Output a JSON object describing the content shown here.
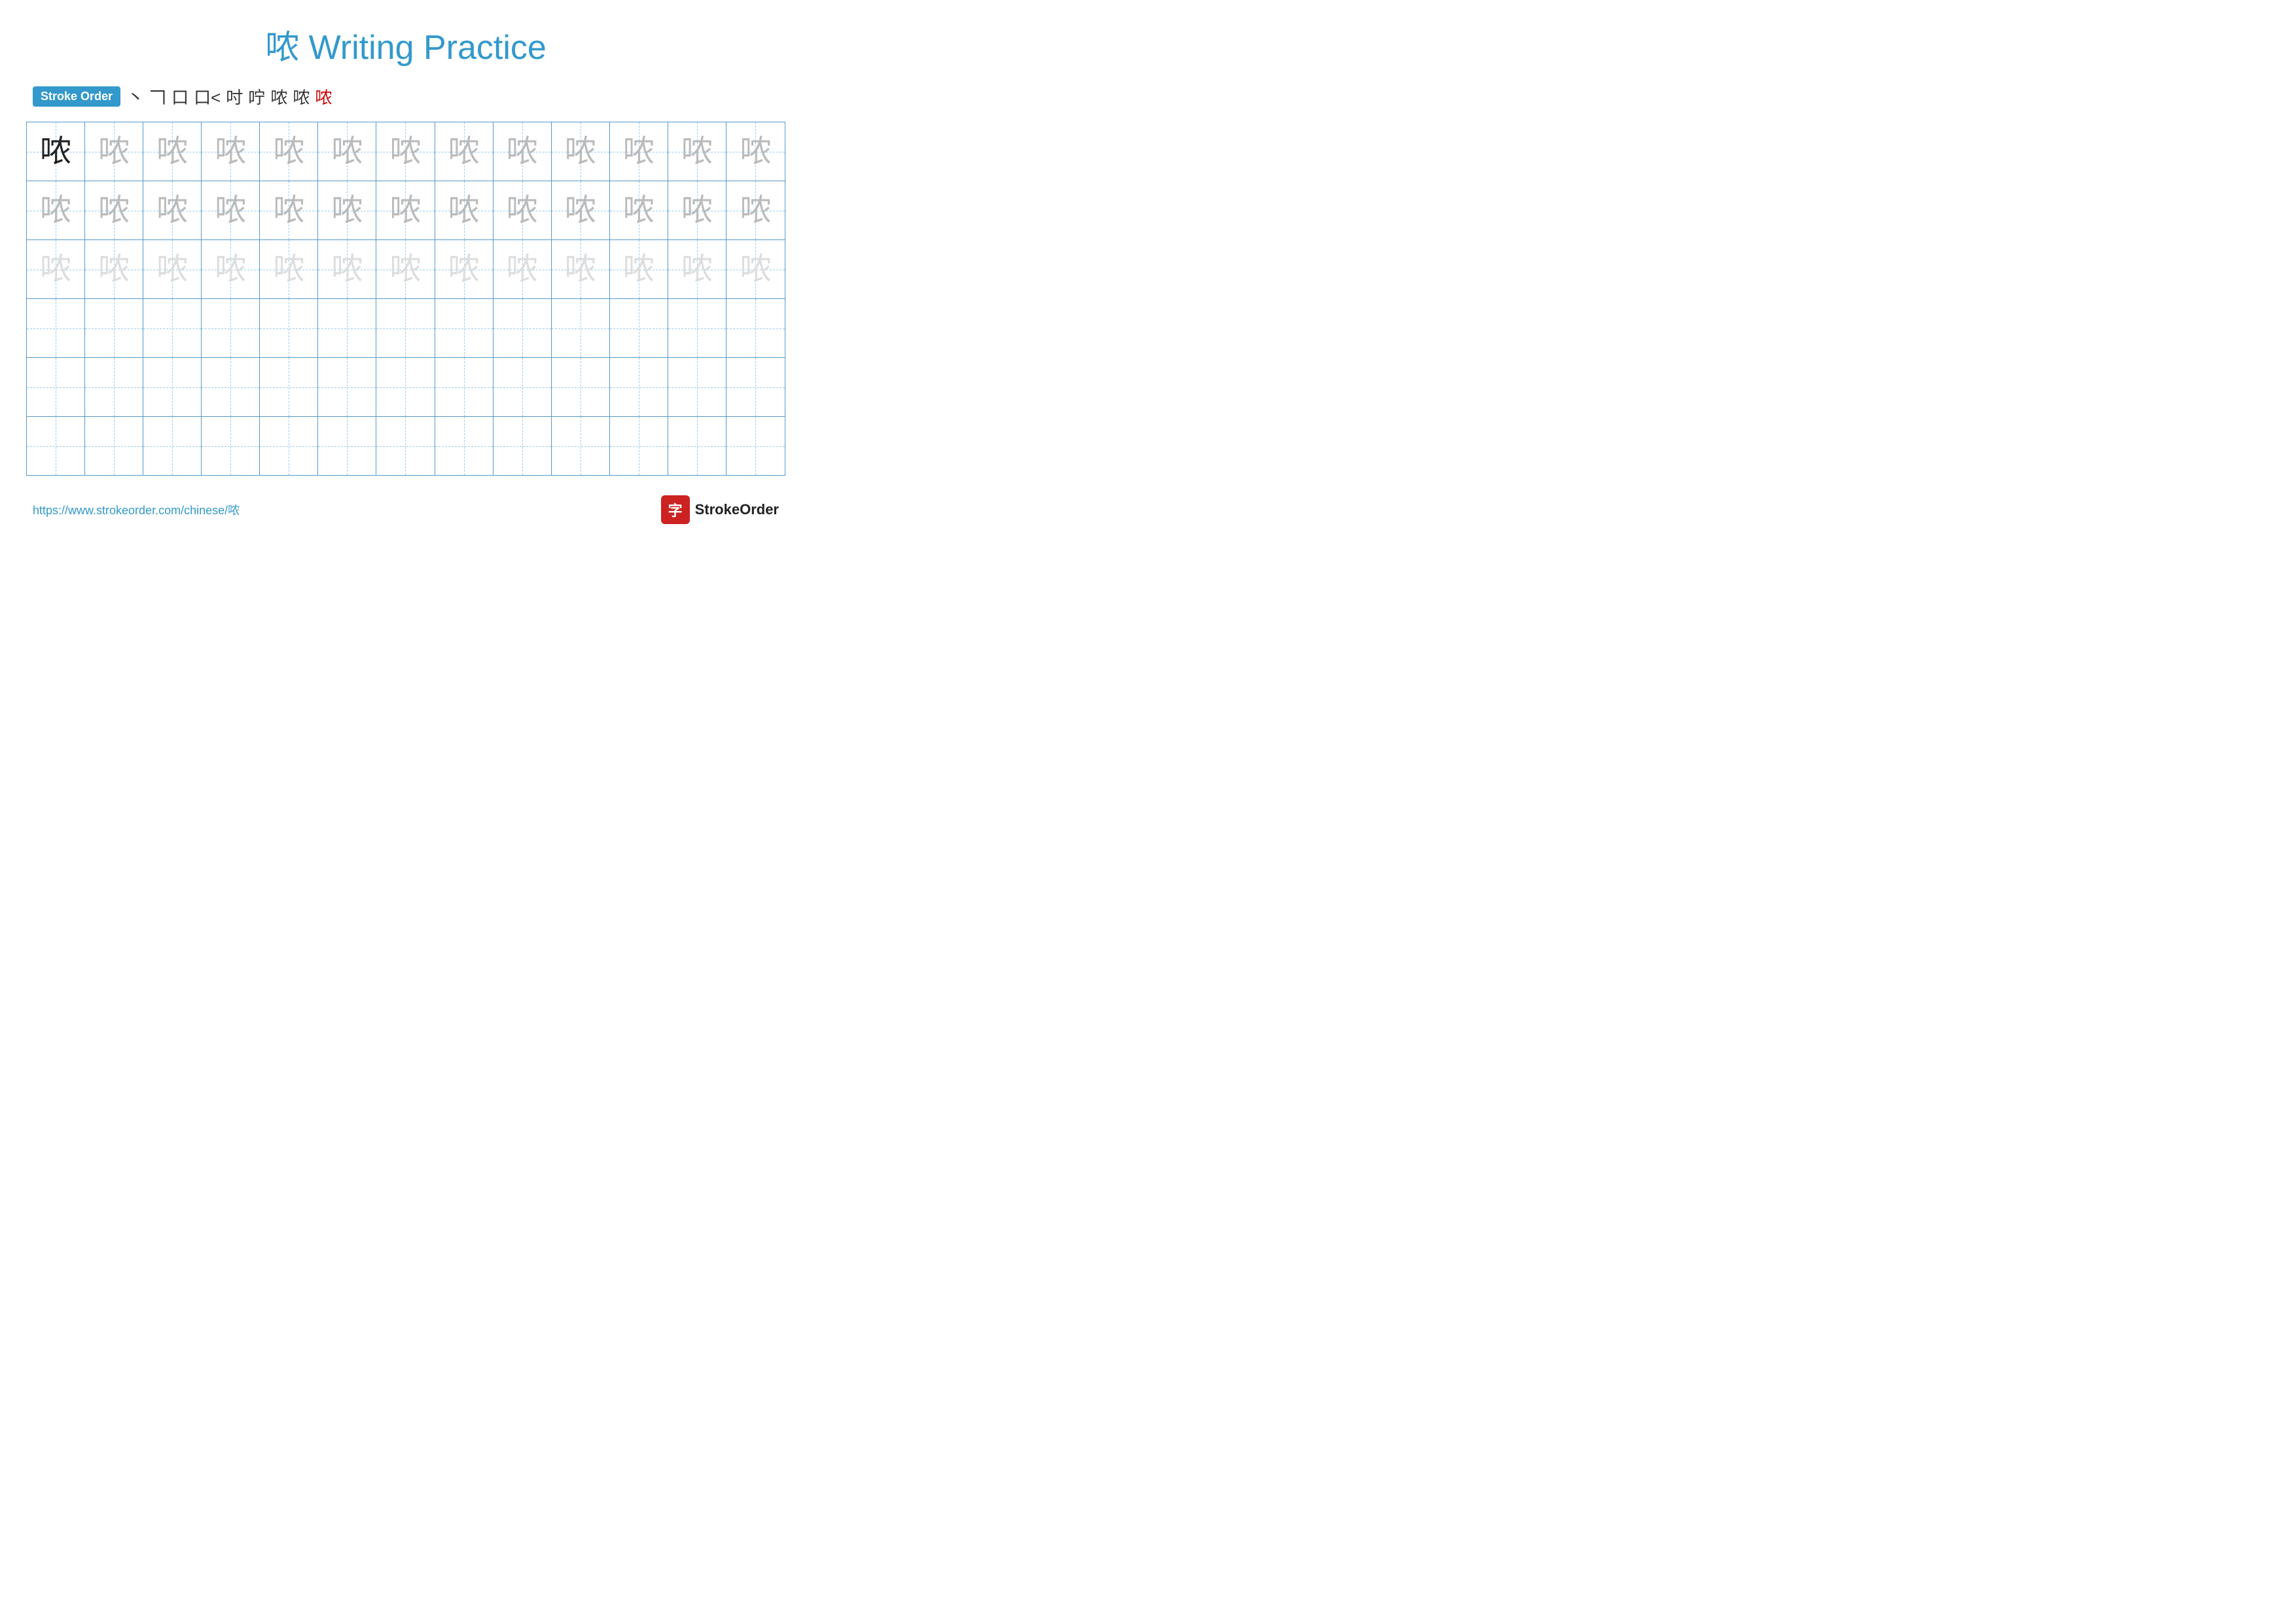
{
  "title": {
    "chinese_char": "哝",
    "label": "Writing Practice",
    "full": "哝 Writing Practice"
  },
  "stroke_order": {
    "badge_label": "Stroke Order",
    "strokes": [
      "丶",
      "𠃍",
      "口",
      "口˂",
      "𠃊𠃍",
      "𠃊𠃍丿",
      "哝⁻",
      "哝",
      "哝"
    ]
  },
  "grid": {
    "rows": 6,
    "cols": 13,
    "character": "哝",
    "row_styles": [
      "dark-then-medium",
      "medium",
      "light",
      "empty",
      "empty",
      "empty"
    ]
  },
  "footer": {
    "url": "https://www.strokeorder.com/chinese/哝",
    "logo_label": "字",
    "brand_name": "StrokeOrder"
  }
}
